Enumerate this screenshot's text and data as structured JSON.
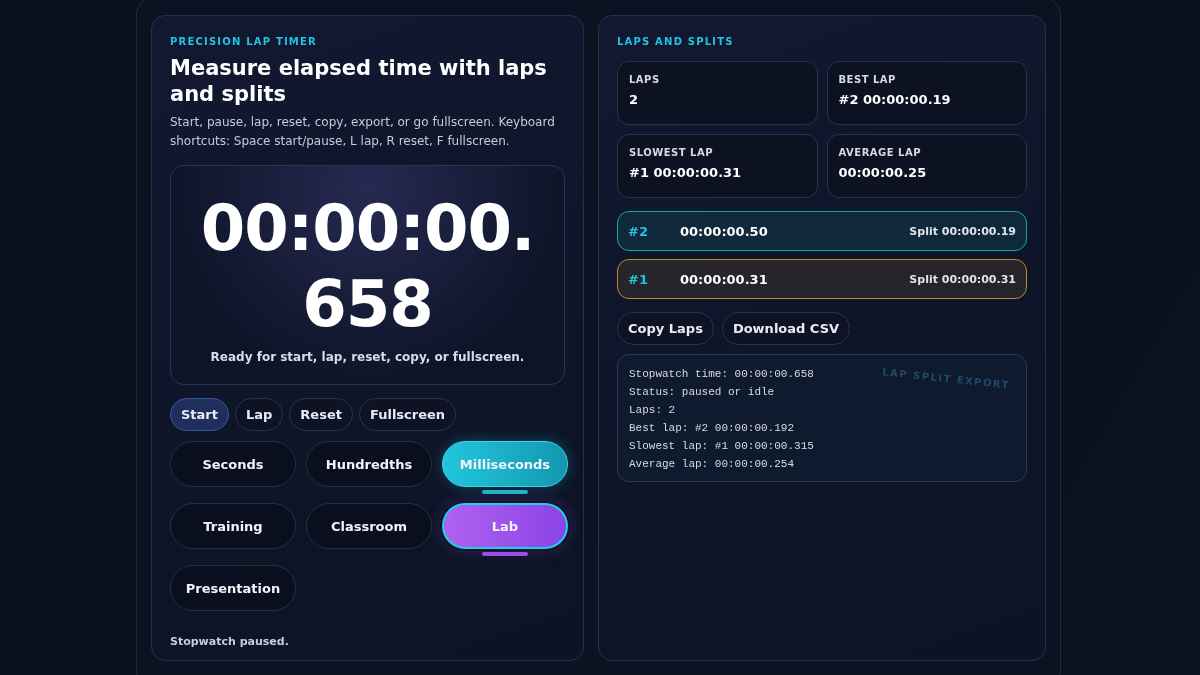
{
  "timer_panel": {
    "eyebrow": "PRECISION LAP TIMER",
    "title": "Measure elapsed time with laps and splits",
    "description": "Start, pause, lap, reset, copy, export, or go fullscreen. Keyboard shortcuts: Space start/pause, L lap, R reset, F fullscreen.",
    "display": {
      "time_main": "00:00:00.",
      "time_fraction": "658",
      "hint": "Ready for start, lap, reset, copy, or fullscreen."
    },
    "actions": [
      {
        "label": "Start",
        "primary": true
      },
      {
        "label": "Lap",
        "primary": false
      },
      {
        "label": "Reset",
        "primary": false
      },
      {
        "label": "Fullscreen",
        "primary": false
      }
    ],
    "precision": [
      {
        "label": "Seconds",
        "selected": false
      },
      {
        "label": "Hundredths",
        "selected": false
      },
      {
        "label": "Milliseconds",
        "selected": true
      }
    ],
    "presets": [
      {
        "label": "Training",
        "selected": false
      },
      {
        "label": "Classroom",
        "selected": false
      },
      {
        "label": "Lab",
        "selected": true
      },
      {
        "label": "Presentation",
        "selected": false
      }
    ],
    "status": "Stopwatch paused."
  },
  "laps_panel": {
    "eyebrow": "LAPS AND SPLITS",
    "stats": [
      {
        "label": "LAPS",
        "value": "2"
      },
      {
        "label": "BEST LAP",
        "value": "#2 00:00:00.19"
      },
      {
        "label": "SLOWEST LAP",
        "value": "#1 00:00:00.31"
      },
      {
        "label": "AVERAGE LAP",
        "value": "00:00:00.25"
      }
    ],
    "laps": [
      {
        "number": "#2",
        "time": "00:00:00.50",
        "split": "Split 00:00:00.19",
        "color": "#14a8a0"
      },
      {
        "number": "#1",
        "time": "00:00:00.31",
        "split": "Split 00:00:00.31",
        "color": "#c28a2e"
      }
    ],
    "buttons": [
      "Copy Laps",
      "Download CSV"
    ],
    "export_lines": [
      "Stopwatch time: 00:00:00.658",
      "Status: paused or idle",
      "Laps: 2",
      "Best lap: #2 00:00:00.192",
      "Slowest lap: #1 00:00:00.315",
      "Average lap: 00:00:00.254"
    ],
    "export_watermark": "LAP SPLIT EXPORT"
  }
}
